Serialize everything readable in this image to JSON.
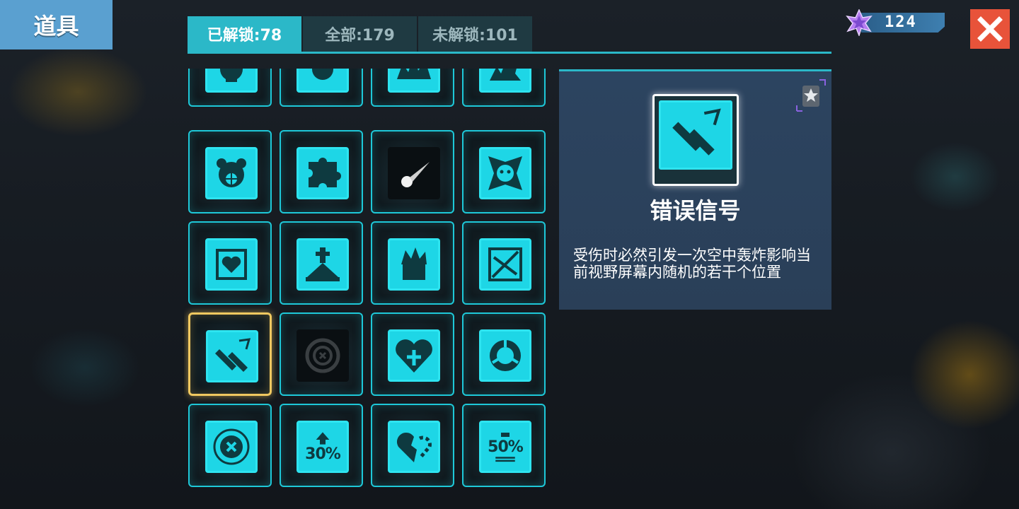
{
  "title": "道具",
  "tabs": [
    {
      "label": "已解锁:78",
      "active": true
    },
    {
      "label": "全部:179",
      "active": false
    },
    {
      "label": "未解锁:101",
      "active": false
    }
  ],
  "currency": {
    "icon": "purple-star-icon",
    "value": "124"
  },
  "close_icon": "close-icon",
  "items": [
    {
      "icon": "pot-icon",
      "locked": false
    },
    {
      "icon": "flame-ball-icon",
      "locked": false
    },
    {
      "icon": "explosion-icon",
      "locked": false
    },
    {
      "icon": "missile-strike-icon",
      "locked": false
    },
    {
      "icon": "bear-target-icon",
      "locked": false
    },
    {
      "icon": "puzzle-icon",
      "locked": false
    },
    {
      "icon": "comet-icon",
      "locked": true
    },
    {
      "icon": "face-shield-icon",
      "locked": false
    },
    {
      "icon": "heart-chip-icon",
      "locked": false
    },
    {
      "icon": "grave-icon",
      "locked": false
    },
    {
      "icon": "fire-box-icon",
      "locked": false
    },
    {
      "icon": "broken-bow-icon",
      "locked": false
    },
    {
      "icon": "bombs-icon",
      "locked": false,
      "selected": true
    },
    {
      "icon": "target-ring-icon",
      "locked": true
    },
    {
      "icon": "heart-cross-icon",
      "locked": false
    },
    {
      "icon": "ring-icon",
      "locked": false
    },
    {
      "icon": "cancel-circle-icon",
      "locked": false
    },
    {
      "icon": "arrow-up-percent-icon",
      "locked": false,
      "text": "30%"
    },
    {
      "icon": "broken-heart-icon",
      "locked": false
    },
    {
      "icon": "battery-percent-icon",
      "locked": false,
      "text": "50%"
    }
  ],
  "detail": {
    "icon": "bombs-icon",
    "rank_icon": "silver-star-badge-icon",
    "name": "错误信号",
    "description": "受伤时必然引发一次空中轰炸影响当前视野屏幕内随机的若干个位置"
  },
  "colors": {
    "accent": "#2bb8c8",
    "icon_fill": "#1ed6e6",
    "selected_border": "#f0c860",
    "close_bg": "#e8533a",
    "title_bg": "#5aa0d0",
    "detail_bg": "#2c4460"
  }
}
